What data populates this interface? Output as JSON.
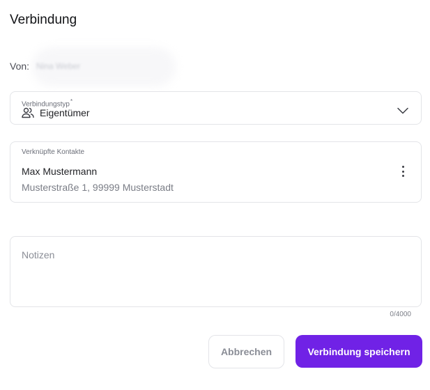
{
  "dialog": {
    "title": "Verbindung"
  },
  "from": {
    "label": "Von:",
    "value": "Nina Weber"
  },
  "connection_type": {
    "label": "Verbindungstyp",
    "required_marker": "*",
    "value": "Eigentümer",
    "icon": "users-icon",
    "dropdown_icon": "chevron-down-icon"
  },
  "linked_contacts": {
    "label": "Verknüpfte Kontakte",
    "contacts": [
      {
        "name": "Max Mustermann",
        "address": "Musterstraße 1, 99999 Musterstadt",
        "menu_icon": "more-vertical-icon"
      }
    ]
  },
  "notes": {
    "placeholder": "Notizen",
    "value": "",
    "counter": "0/4000"
  },
  "actions": {
    "cancel_label": "Abbrechen",
    "save_label": "Verbindung speichern"
  },
  "colors": {
    "primary": "#7022e6",
    "border": "#e3e4e8",
    "muted_text": "#7a7d86"
  }
}
